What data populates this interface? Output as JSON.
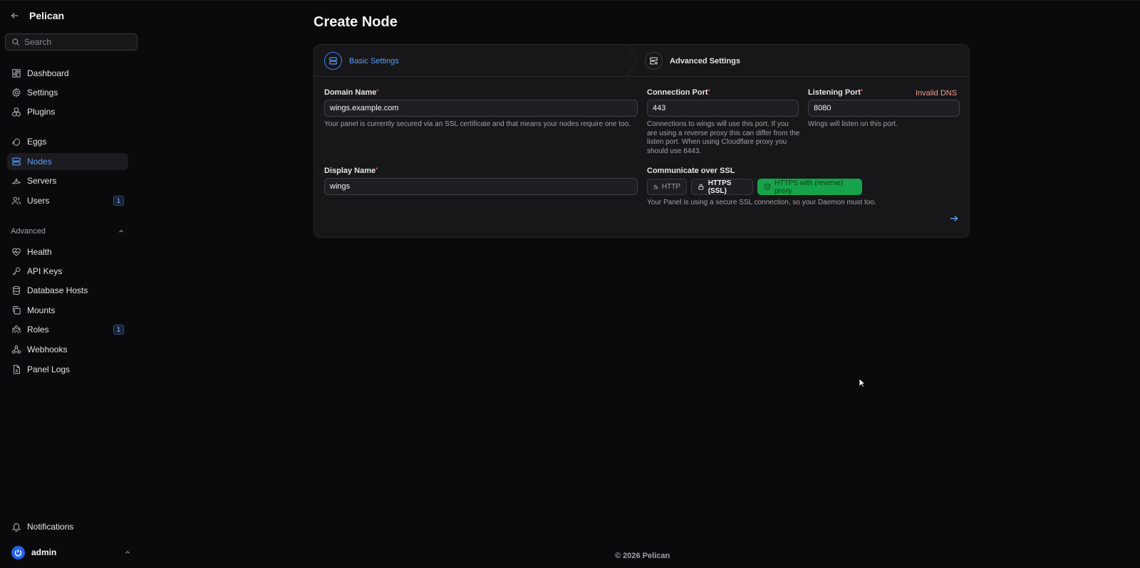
{
  "app": {
    "title": "Pelican",
    "footer": "© 2026 Pelican"
  },
  "search": {
    "placeholder": "Search"
  },
  "sidebar": {
    "items": [
      {
        "label": "Dashboard",
        "icon": "dashboard-icon"
      },
      {
        "label": "Settings",
        "icon": "gear-icon"
      },
      {
        "label": "Plugins",
        "icon": "plugins-icon"
      },
      {
        "label": "Eggs",
        "icon": "egg-icon"
      },
      {
        "label": "Nodes",
        "icon": "server-icon",
        "active": true
      },
      {
        "label": "Servers",
        "icon": "brand-icon"
      },
      {
        "label": "Users",
        "icon": "users-icon",
        "badge": "1"
      }
    ],
    "advanced": {
      "label": "Advanced",
      "items": [
        {
          "label": "Health",
          "icon": "heart-icon"
        },
        {
          "label": "API Keys",
          "icon": "key-icon"
        },
        {
          "label": "Database Hosts",
          "icon": "database-icon"
        },
        {
          "label": "Mounts",
          "icon": "mounts-icon"
        },
        {
          "label": "Roles",
          "icon": "roles-icon",
          "badge": "1"
        },
        {
          "label": "Webhooks",
          "icon": "webhook-icon"
        },
        {
          "label": "Panel Logs",
          "icon": "file-icon"
        }
      ]
    },
    "notifications": "Notifications",
    "user": {
      "name": "admin"
    }
  },
  "page": {
    "title": "Create Node",
    "steps": [
      {
        "label": "Basic Settings",
        "active": true
      },
      {
        "label": "Advanced Settings",
        "active": false
      }
    ],
    "form": {
      "domain": {
        "label": "Domain Name",
        "required": "*",
        "error": "Invalid DNS",
        "value": "wings.example.com",
        "hint": "Your panel is currently secured via an SSL certificate and that means your nodes require one too."
      },
      "connection_port": {
        "label": "Connection Port",
        "required": "*",
        "value": "443",
        "hint": "Connections to wings will use this port. If you are using a reverse proxy this can differ from the listen port. When using Cloudflare proxy you should use 8443."
      },
      "listening_port": {
        "label": "Listening Port",
        "required": "*",
        "value": "8080",
        "hint": "Wings will listen on this port."
      },
      "display_name": {
        "label": "Display Name",
        "required": "*",
        "value": "wings"
      },
      "ssl": {
        "label": "Communicate over SSL",
        "options": [
          "HTTP",
          "HTTPS (SSL)",
          "HTTPS with (reverse) proxy"
        ],
        "selected": "HTTPS with (reverse) proxy",
        "hint": "Your Panel is using a secure SSL connection, so your Daemon must too."
      }
    }
  },
  "colors": {
    "accent": "#5b9cf8",
    "selected": "#16a34a",
    "error": "#f59e8a",
    "background": "#0a0a0c"
  }
}
